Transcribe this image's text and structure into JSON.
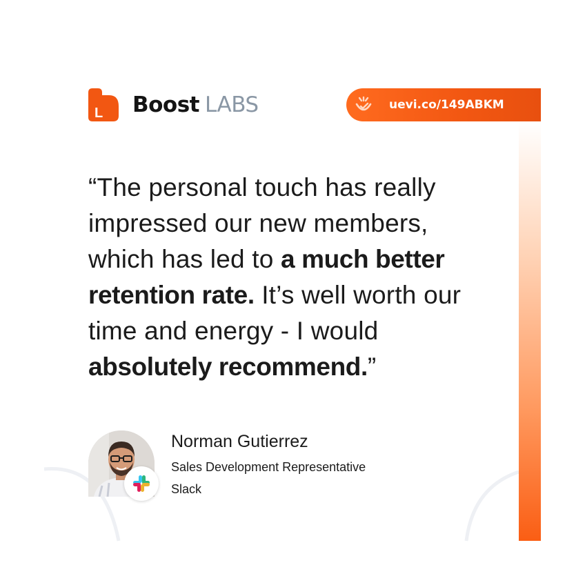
{
  "brand": {
    "name_bold": "Boost",
    "name_light": "LABS",
    "logo_letter": "L",
    "icon": "boost-logo-icon",
    "accent": "#f25712"
  },
  "link": {
    "text": "uevi.co/149ABKM",
    "icon": "uevi-check-icon"
  },
  "quote": {
    "lines": [
      [
        {
          "t": "“The personal touch has really",
          "b": false
        }
      ],
      [
        {
          "t": "impressed our new members,",
          "b": false
        }
      ],
      [
        {
          "t": "which has led to ",
          "b": false
        },
        {
          "t": "a much better",
          "b": true
        }
      ],
      [
        {
          "t": "retention rate.",
          "b": true
        },
        {
          "t": " It’s well worth our",
          "b": false
        }
      ],
      [
        {
          "t": "time and energy - I would",
          "b": false
        }
      ],
      [
        {
          "t": "absolutely recommend.",
          "b": true
        },
        {
          "t": "”",
          "b": false
        }
      ]
    ]
  },
  "author": {
    "name": "Norman Gutierrez",
    "role": "Sales Development Representative",
    "company": "Slack",
    "company_icon": "slack-logo-icon"
  }
}
